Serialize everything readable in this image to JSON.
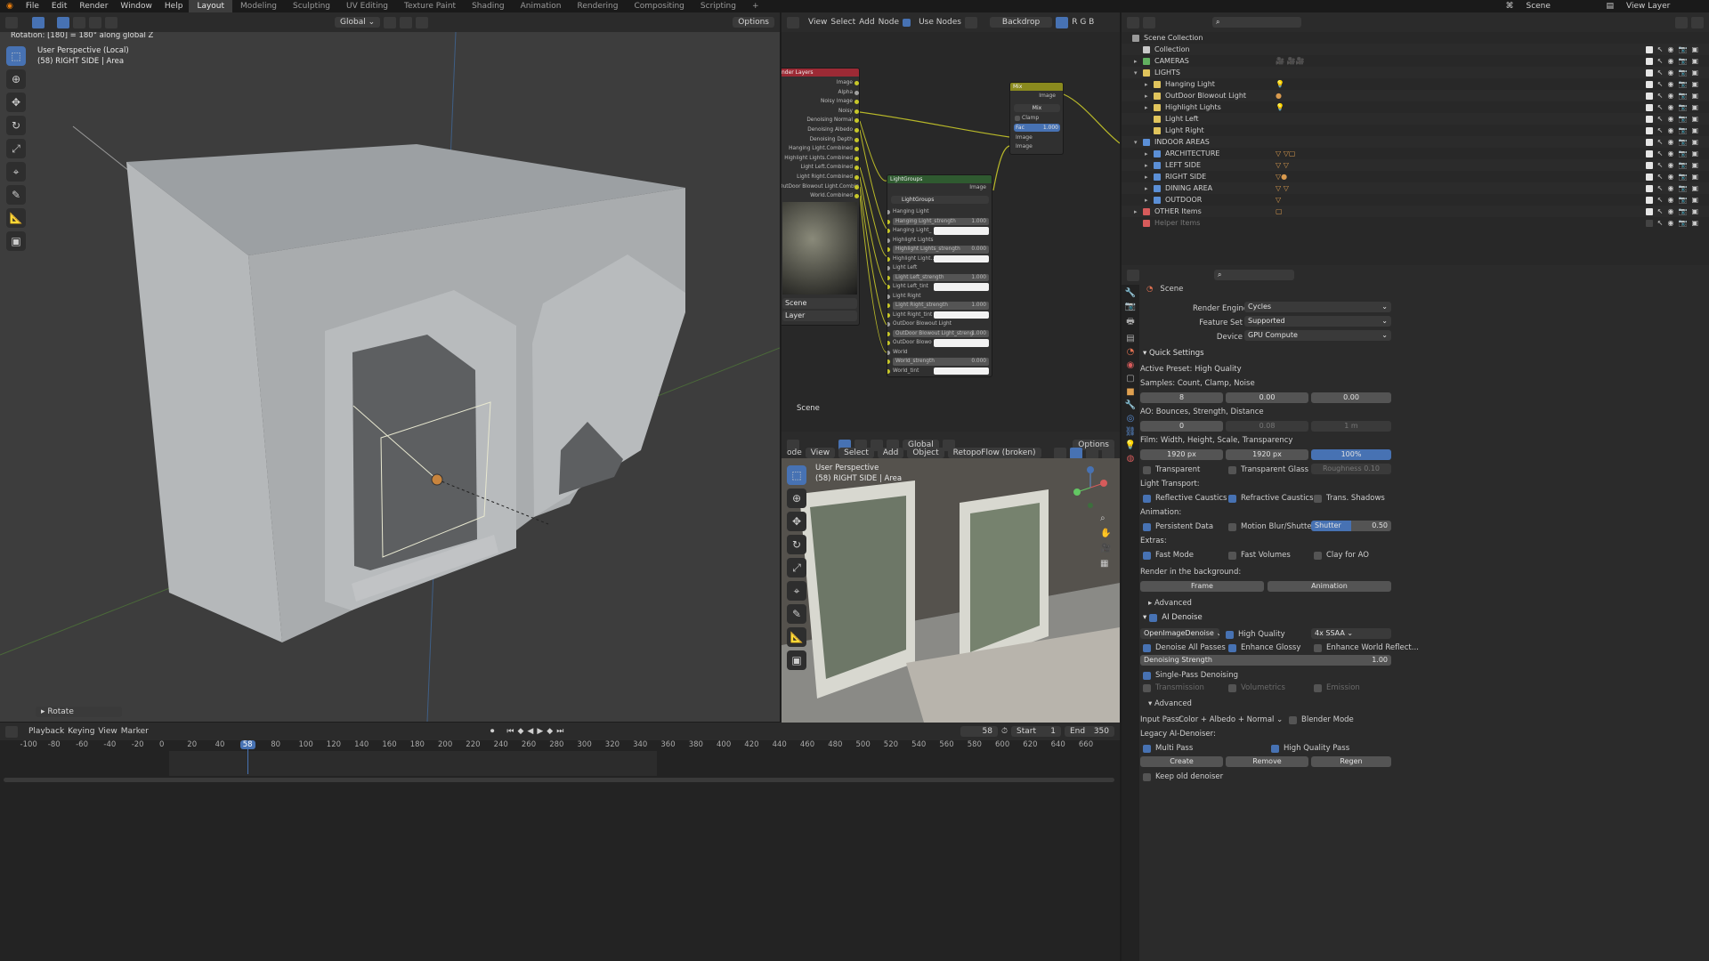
{
  "menubar": {
    "items": [
      "File",
      "Edit",
      "Render",
      "Window",
      "Help"
    ],
    "workspaces": [
      "Layout",
      "Modeling",
      "Sculpting",
      "UV Editing",
      "Texture Paint",
      "Shading",
      "Animation",
      "Rendering",
      "Compositing",
      "Scripting"
    ],
    "active_workspace": "Layout",
    "scene": "Scene",
    "view_layer": "View Layer"
  },
  "viewport": {
    "transform_orientation": "Global",
    "options": "Options",
    "status": "Rotation: [180] = 180° along global Z",
    "view_title": "User Perspective (Local)",
    "view_subtitle": "(58) RIGHT SIDE | Area",
    "operator_panel": "Rotate"
  },
  "node_editor": {
    "menus": [
      "View",
      "Select",
      "Add",
      "Node"
    ],
    "use_nodes": "Use Nodes",
    "backdrop": "Backdrop",
    "scene_label": "Scene",
    "render_layers": {
      "title": "nder Layers",
      "outputs": [
        "Image",
        "Alpha",
        "Noisy Image",
        "Noisy",
        "Denoising Normal",
        "Denoising Albedo",
        "Denoising Depth",
        "Hanging Light.Combined",
        "Highlight Lights.Combined",
        "Light Left.Combined",
        "Light Right.Combined",
        "OutDoor Blowout Light.Combined",
        "World.Combined"
      ],
      "scene_field": "Scene",
      "layer_field": "Layer"
    },
    "mix": {
      "title": "Mix",
      "output": "Image",
      "mode": "Mix",
      "clamp": "Clamp",
      "fac": "Fac",
      "fac_value": "1.000",
      "inputs": [
        "Image",
        "Image"
      ]
    },
    "lightgroups": {
      "title": "LightGroups",
      "output": "Image",
      "group": "LightGroups",
      "rows": [
        {
          "label": "Hanging Light",
          "type": "label"
        },
        {
          "label": "Hanging Light_strength",
          "value": "1.000",
          "type": "num"
        },
        {
          "label": "Hanging Light_",
          "type": "color"
        },
        {
          "label": "Highlight Lights",
          "type": "label"
        },
        {
          "label": "Highlight Lights_strength",
          "value": "0.000",
          "type": "num"
        },
        {
          "label": "Highlight Light...",
          "type": "color"
        },
        {
          "label": "Light Left",
          "type": "label"
        },
        {
          "label": "Light Left_strength",
          "value": "1.000",
          "type": "num"
        },
        {
          "label": "Light Left_tint",
          "type": "color"
        },
        {
          "label": "Light Right",
          "type": "label"
        },
        {
          "label": "Light Right_strength",
          "value": "1.000",
          "type": "num"
        },
        {
          "label": "Light Right_tint",
          "type": "color"
        },
        {
          "label": "OutDoor Blowout Light",
          "type": "label"
        },
        {
          "label": "OutDoor Blowout Light_streng",
          "value": "1.000",
          "type": "num"
        },
        {
          "label": "OutDoor Blowo",
          "type": "color"
        },
        {
          "label": "World",
          "type": "label"
        },
        {
          "label": "World_strength",
          "value": "0.000",
          "type": "num"
        },
        {
          "label": "World_tint",
          "type": "color"
        }
      ]
    }
  },
  "viewport2": {
    "menus": [
      "ode",
      "View",
      "Select",
      "Add",
      "Object"
    ],
    "addon": "RetopoFlow (broken)",
    "orientation": "Global",
    "options": "Options",
    "view_title": "User Perspective",
    "view_subtitle": "(58) RIGHT SIDE | Area"
  },
  "outliner": {
    "root": "Scene Collection",
    "items": [
      {
        "label": "Collection",
        "depth": 1,
        "color": "#c8c8c8",
        "expanded": false,
        "arrow": false,
        "icons": ""
      },
      {
        "label": "CAMERAS",
        "depth": 1,
        "color": "#62b060",
        "arrow": true,
        "icons": "🎥 🎥🎥"
      },
      {
        "label": "LIGHTS",
        "depth": 1,
        "color": "#e0c45c",
        "arrow": true,
        "open": true,
        "icons": ""
      },
      {
        "label": "Hanging Light",
        "depth": 2,
        "color": "#e0c45c",
        "arrow": true,
        "icons": "💡"
      },
      {
        "label": "OutDoor Blowout Light",
        "depth": 2,
        "color": "#e0c45c",
        "arrow": true,
        "icons": "●"
      },
      {
        "label": "Highlight Lights",
        "depth": 2,
        "color": "#e0c45c",
        "arrow": true,
        "icons": "💡"
      },
      {
        "label": "Light Left",
        "depth": 2,
        "color": "#e0c45c",
        "arrow": false,
        "icons": ""
      },
      {
        "label": "Light Right",
        "depth": 2,
        "color": "#e0c45c",
        "arrow": false,
        "icons": ""
      },
      {
        "label": "INDOOR AREAS",
        "depth": 1,
        "color": "#5b8fd6",
        "arrow": true,
        "open": true,
        "icons": ""
      },
      {
        "label": "ARCHITECTURE",
        "depth": 2,
        "color": "#5b8fd6",
        "arrow": true,
        "icons": "▽ ▽▢"
      },
      {
        "label": "LEFT SIDE",
        "depth": 2,
        "color": "#5b8fd6",
        "arrow": true,
        "icons": "▽ ▽"
      },
      {
        "label": "RIGHT SIDE",
        "depth": 2,
        "color": "#5b8fd6",
        "arrow": true,
        "icons": "▽●"
      },
      {
        "label": "DINING AREA",
        "depth": 2,
        "color": "#5b8fd6",
        "arrow": true,
        "icons": "▽ ▽"
      },
      {
        "label": "OUTDOOR",
        "depth": 2,
        "color": "#5b8fd6",
        "arrow": true,
        "icons": "▽"
      },
      {
        "label": "OTHER Items",
        "depth": 1,
        "color": "#d65b5b",
        "arrow": true,
        "icons": "▢"
      },
      {
        "label": "Helper Items",
        "depth": 1,
        "color": "#d65b5b",
        "arrow": false,
        "dim": true,
        "icons": ""
      }
    ]
  },
  "properties": {
    "title": "Scene",
    "render_engine_label": "Render Engine",
    "render_engine": "Cycles",
    "feature_set_label": "Feature Set",
    "feature_set": "Supported",
    "device_label": "Device",
    "device": "GPU Compute",
    "quick": {
      "title": "Quick Settings",
      "preset": "Active Preset: High Quality",
      "samples_label": "Samples: Count, Clamp, Noise",
      "samples": [
        "8",
        "0.00",
        "0.00"
      ],
      "ao_label": "AO: Bounces, Strength, Distance",
      "ao": [
        "0",
        "0.08",
        "1 m"
      ],
      "film_label": "Film: Width, Height, Scale, Transparency",
      "film": [
        "1920 px",
        "1920 px",
        "100%"
      ],
      "transparent": "Transparent",
      "transparent_glass": "Transparent Glass",
      "roughness": "Roughness",
      "roughness_value": "0.10",
      "light_transport": "Light Transport:",
      "reflective": "Reflective Caustics",
      "refractive": "Refractive Caustics",
      "trans_shadows": "Trans. Shadows",
      "animation": "Animation:",
      "persistent": "Persistent Data",
      "motion_blur": "Motion Blur/Shutter",
      "shutter": "Shutter",
      "shutter_value": "0.50",
      "extras": "Extras:",
      "fast_mode": "Fast Mode",
      "fast_volumes": "Fast Volumes",
      "clay": "Clay for AO",
      "render_bg": "Render in the background:",
      "frame": "Frame",
      "anim": "Animation",
      "advanced": "Advanced"
    },
    "denoise": {
      "title": "AI Denoise",
      "denoiser": "OpenImageDenoise",
      "high_quality": "High Quality",
      "ssaa": "4x SSAA",
      "all_passes": "Denoise All Passes",
      "enhance_glossy": "Enhance Glossy",
      "enhance_world": "Enhance World Reflect...",
      "strength_label": "Denoising Strength",
      "strength": "1.00",
      "single_pass": "Single-Pass Denoising",
      "transmission": "Transmission",
      "volumetrics": "Volumetrics",
      "emission": "Emission",
      "advanced": "Advanced",
      "input_pass_label": "Input Pass:",
      "input_pass": "Color + Albedo + Normal",
      "blender_mode": "Blender Mode",
      "legacy": "Legacy AI-Denoiser:",
      "multi_pass": "Multi Pass",
      "hq_pass": "High Quality Pass",
      "create": "Create",
      "remove": "Remove",
      "regen": "Regen",
      "keep_old": "Keep old denoiser"
    }
  },
  "timeline": {
    "menus": [
      "Playback",
      "Keying",
      "View",
      "Marker"
    ],
    "current_frame": "58",
    "start_label": "Start",
    "start": "1",
    "end_label": "End",
    "end": "350",
    "ticks": [
      "-100",
      "-80",
      "-60",
      "-40",
      "-20",
      "0",
      "20",
      "40",
      "58",
      "80",
      "100",
      "120",
      "140",
      "160",
      "180",
      "200",
      "220",
      "240",
      "260",
      "280",
      "300",
      "320",
      "340",
      "360",
      "380",
      "400",
      "420",
      "440",
      "460",
      "480",
      "500",
      "520",
      "540",
      "560",
      "580",
      "600",
      "620",
      "640",
      "660"
    ]
  },
  "colors": {
    "accent": "#4772b3",
    "node_red": "#9c2a35",
    "node_green": "#2f5a30",
    "node_yellow": "#8a8a1e",
    "socket": "#c7c729"
  }
}
